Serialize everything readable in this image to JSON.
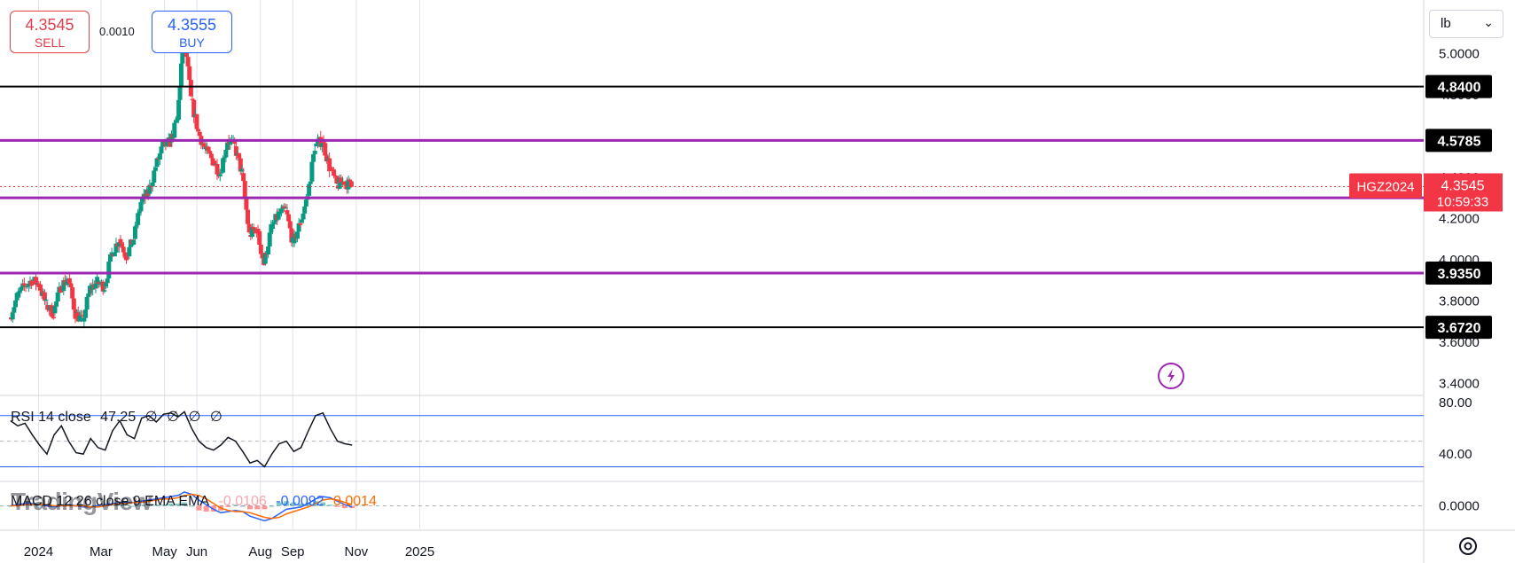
{
  "trade": {
    "sell_price": "4.3545",
    "sell_label": "SELL",
    "spread": "0.0010",
    "buy_price": "4.3555",
    "buy_label": "BUY"
  },
  "unit": "lb",
  "colors": {
    "up": "#089981",
    "down": "#f23645",
    "purple": "#9c27b0",
    "black": "#000000",
    "rsi_band": "#2962ff",
    "macd_line": "#2962ff",
    "signal_line": "#ff6d00",
    "price_tag": "#f23645"
  },
  "icons": {
    "unit_chevron": "chevron-down-icon",
    "alert": "lightning-icon",
    "settings": "settings-icon"
  },
  "rsi_legend": {
    "name": "RSI 14 close",
    "value": "47.25",
    "extra": [
      "∅",
      "∅",
      "∅",
      "∅"
    ]
  },
  "macd_legend": {
    "name": "MACD 12 26 close 9 EMA EMA",
    "hist": "-0.0106",
    "macd": "-0.0092",
    "signal": "0.0014"
  },
  "logo_text": "TradingView",
  "chart_data": {
    "type": "candlestick",
    "symbol": "HGZ2024",
    "last_price": "4.3545",
    "countdown": "10:59:33",
    "price_axis": {
      "ticks": [
        "5.0000",
        "4.8000",
        "4.6000",
        "4.4000",
        "4.2000",
        "4.0000",
        "3.8000",
        "3.6000",
        "3.4000"
      ],
      "range": [
        3.35,
        5.26
      ]
    },
    "time_axis": {
      "ticks": [
        "2024",
        "Mar",
        "May",
        "Jun",
        "Aug",
        "Sep",
        "Nov",
        "2025"
      ]
    },
    "levels": [
      {
        "price": 4.84,
        "label": "4.8400",
        "color": "black"
      },
      {
        "price": 4.5785,
        "label": "4.5785",
        "color": "purple"
      },
      {
        "price": 4.3,
        "label": "4.3000",
        "color": "purple"
      },
      {
        "price": 3.935,
        "label": "3.9350",
        "color": "purple"
      },
      {
        "price": 3.672,
        "label": "3.6720",
        "color": "black"
      }
    ],
    "close_series": [
      {
        "date": "2023-12-05",
        "close": 3.72
      },
      {
        "date": "2023-12-12",
        "close": 3.82
      },
      {
        "date": "2023-12-19",
        "close": 3.87
      },
      {
        "date": "2023-12-26",
        "close": 3.9
      },
      {
        "date": "2024-01-02",
        "close": 3.88
      },
      {
        "date": "2024-01-09",
        "close": 3.78
      },
      {
        "date": "2024-01-16",
        "close": 3.74
      },
      {
        "date": "2024-01-23",
        "close": 3.87
      },
      {
        "date": "2024-01-30",
        "close": 3.91
      },
      {
        "date": "2024-02-06",
        "close": 3.74
      },
      {
        "date": "2024-02-13",
        "close": 3.7
      },
      {
        "date": "2024-02-20",
        "close": 3.86
      },
      {
        "date": "2024-02-27",
        "close": 3.89
      },
      {
        "date": "2024-03-05",
        "close": 3.87
      },
      {
        "date": "2024-03-12",
        "close": 4.03
      },
      {
        "date": "2024-03-19",
        "close": 4.1
      },
      {
        "date": "2024-03-26",
        "close": 4.02
      },
      {
        "date": "2024-04-02",
        "close": 4.1
      },
      {
        "date": "2024-04-09",
        "close": 4.28
      },
      {
        "date": "2024-04-16",
        "close": 4.32
      },
      {
        "date": "2024-04-23",
        "close": 4.45
      },
      {
        "date": "2024-04-30",
        "close": 4.55
      },
      {
        "date": "2024-05-07",
        "close": 4.57
      },
      {
        "date": "2024-05-14",
        "close": 4.68
      },
      {
        "date": "2024-05-20",
        "close": 5.12
      },
      {
        "date": "2024-05-27",
        "close": 4.78
      },
      {
        "date": "2024-06-03",
        "close": 4.62
      },
      {
        "date": "2024-06-10",
        "close": 4.53
      },
      {
        "date": "2024-06-17",
        "close": 4.48
      },
      {
        "date": "2024-06-24",
        "close": 4.42
      },
      {
        "date": "2024-07-01",
        "close": 4.58
      },
      {
        "date": "2024-07-08",
        "close": 4.55
      },
      {
        "date": "2024-07-15",
        "close": 4.42
      },
      {
        "date": "2024-07-22",
        "close": 4.12
      },
      {
        "date": "2024-07-29",
        "close": 4.15
      },
      {
        "date": "2024-08-05",
        "close": 3.98
      },
      {
        "date": "2024-08-12",
        "close": 4.15
      },
      {
        "date": "2024-08-19",
        "close": 4.22
      },
      {
        "date": "2024-08-26",
        "close": 4.24
      },
      {
        "date": "2024-09-02",
        "close": 4.08
      },
      {
        "date": "2024-09-09",
        "close": 4.18
      },
      {
        "date": "2024-09-16",
        "close": 4.31
      },
      {
        "date": "2024-09-23",
        "close": 4.55
      },
      {
        "date": "2024-09-30",
        "close": 4.58
      },
      {
        "date": "2024-10-07",
        "close": 4.45
      },
      {
        "date": "2024-10-14",
        "close": 4.36
      },
      {
        "date": "2024-10-21",
        "close": 4.38
      },
      {
        "date": "2024-10-28",
        "close": 4.355
      }
    ],
    "rsi": {
      "levels": [
        70,
        30
      ],
      "ticks": [
        "80.00",
        "40.00"
      ],
      "values": [
        66,
        62,
        64,
        55,
        47,
        40,
        55,
        62,
        50,
        41,
        40,
        52,
        45,
        43,
        58,
        66,
        55,
        52,
        68,
        70,
        65,
        71,
        72,
        69,
        73,
        60,
        50,
        45,
        43,
        47,
        53,
        50,
        42,
        33,
        35,
        30,
        40,
        48,
        50,
        42,
        45,
        58,
        70,
        72,
        60,
        50,
        48,
        47
      ]
    },
    "macd": {
      "ticks": [
        "0.0000"
      ],
      "macd": [
        0.0,
        0.01,
        0.02,
        0.02,
        0.01,
        0.0,
        -0.01,
        0.0,
        0.01,
        0.0,
        -0.01,
        -0.01,
        0.0,
        0.01,
        0.02,
        0.03,
        0.03,
        0.03,
        0.04,
        0.05,
        0.06,
        0.07,
        0.08,
        0.09,
        0.12,
        0.1,
        0.05,
        0.01,
        -0.03,
        -0.06,
        -0.05,
        -0.04,
        -0.05,
        -0.09,
        -0.11,
        -0.13,
        -0.11,
        -0.07,
        -0.03,
        -0.02,
        -0.01,
        0.02,
        0.06,
        0.08,
        0.07,
        0.04,
        0.01,
        -0.01
      ],
      "signal": [
        0.0,
        0.0,
        0.01,
        0.01,
        0.01,
        0.01,
        0.0,
        0.0,
        0.0,
        0.0,
        0.0,
        -0.01,
        -0.01,
        0.0,
        0.01,
        0.02,
        0.02,
        0.03,
        0.03,
        0.04,
        0.05,
        0.06,
        0.06,
        0.07,
        0.09,
        0.1,
        0.09,
        0.06,
        0.02,
        -0.02,
        -0.04,
        -0.05,
        -0.05,
        -0.06,
        -0.08,
        -0.1,
        -0.11,
        -0.1,
        -0.07,
        -0.05,
        -0.03,
        -0.01,
        0.02,
        0.05,
        0.06,
        0.05,
        0.03,
        0.01
      ]
    }
  }
}
